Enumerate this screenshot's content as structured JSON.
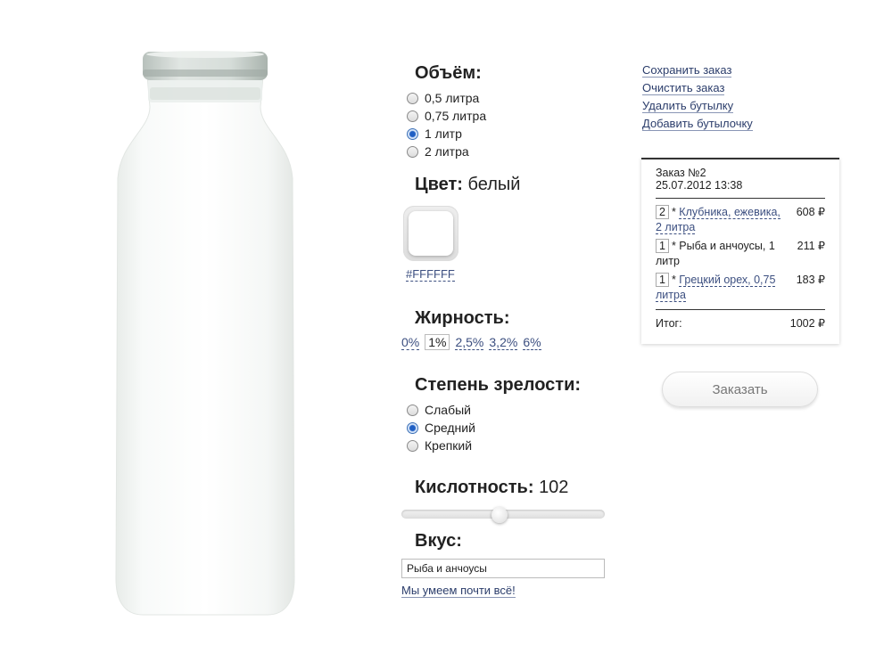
{
  "volume": {
    "title": "Объём:",
    "options": [
      "0,5 литра",
      "0,75 литра",
      "1 литр",
      "2 литра"
    ],
    "selected": 2
  },
  "color": {
    "title": "Цвет:",
    "value": "белый",
    "hex": "#FFFFFF"
  },
  "fat": {
    "title": "Жирность:",
    "options": [
      "0%",
      "1%",
      "2,5%",
      "3,2%",
      "6%"
    ],
    "selected": 1
  },
  "ripeness": {
    "title": "Степень зрелости:",
    "options": [
      "Слабый",
      "Средний",
      "Крепкий"
    ],
    "selected": 1
  },
  "acidity": {
    "title": "Кислотность:",
    "value": "102",
    "level": 0.48
  },
  "taste": {
    "title": "Вкус:",
    "input_value": "Рыба и анчоусы",
    "hint_link": "Мы умеем почти всё!"
  },
  "actions": {
    "save": "Сохранить заказ",
    "clear": "Очистить заказ",
    "delete_bottle": "Удалить бутылку",
    "add_bottle": "Добавить бутылочку"
  },
  "receipt": {
    "title": "Заказ №2",
    "date": "25.07.2012 13:38",
    "items": [
      {
        "qty": "2",
        "name_linked": "Клубника, ежевика, 2 литра",
        "name_plain": "",
        "price": "608 ₽"
      },
      {
        "qty": "1",
        "name_linked": "",
        "name_plain": "Рыба и анчоусы, 1 литр",
        "price": "211 ₽"
      },
      {
        "qty": "1",
        "name_linked": "Грецкий орех, 0,75 литра",
        "name_plain": "",
        "price": "183 ₽"
      }
    ],
    "total_label": "Итог:",
    "total_value": "1002 ₽"
  },
  "order_button": "Заказать",
  "colors": {
    "link": "#2b3d6b",
    "radio_selected": "#1f5fc4"
  }
}
